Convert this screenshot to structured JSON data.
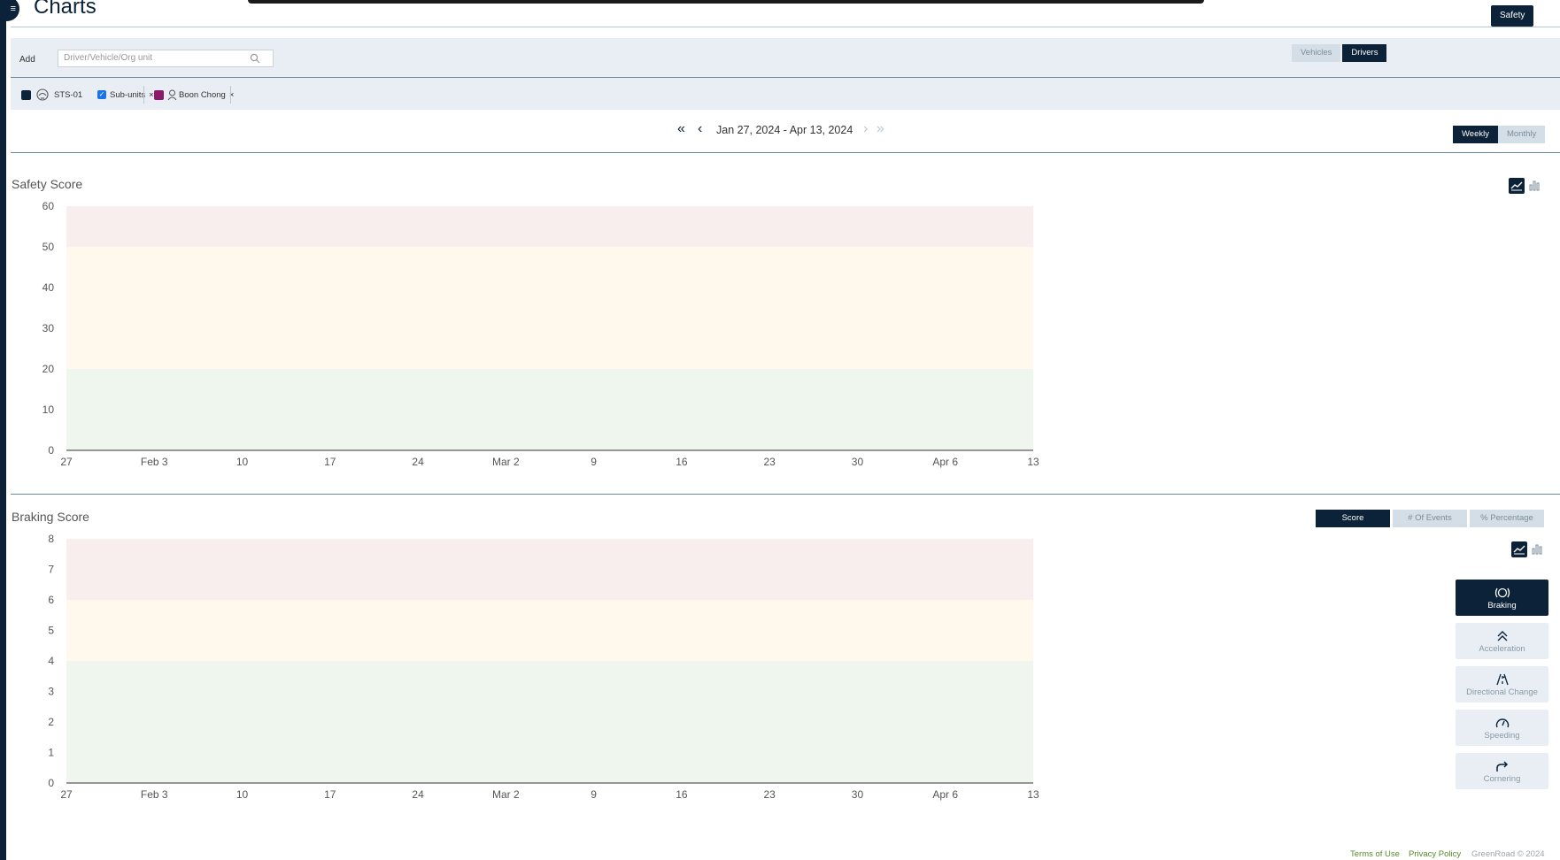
{
  "header": {
    "title": "Charts",
    "mode_button": "Safety"
  },
  "add_bar": {
    "label": "Add",
    "placeholder": "Driver/Vehicle/Org unit",
    "entity_toggle": [
      {
        "label": "Vehicles",
        "active": false
      },
      {
        "label": "Drivers",
        "active": true
      }
    ]
  },
  "filters": {
    "org_unit": {
      "label": "STS-01",
      "color": "#0b2238"
    },
    "subunits": {
      "label": "Sub-units",
      "checked": true
    },
    "driver": {
      "label": "Boon Chong",
      "color": "#8b1a6b"
    },
    "remove_symbol": "×"
  },
  "date_range": {
    "label": "Jan 27, 2024 - Apr 13, 2024"
  },
  "period_toggle": [
    {
      "label": "Weekly",
      "active": true
    },
    {
      "label": "Monthly",
      "active": false
    }
  ],
  "braking_toggle": [
    {
      "label": "Score",
      "active": true
    },
    {
      "label": "# Of Events",
      "active": false
    },
    {
      "label": "% Percentage",
      "active": false
    }
  ],
  "metrics": [
    {
      "label": "Braking",
      "icon": "braking-icon",
      "active": true
    },
    {
      "label": "Acceleration",
      "icon": "acceleration-icon",
      "active": false
    },
    {
      "label": "Directional Change",
      "icon": "directional-change-icon",
      "active": false
    },
    {
      "label": "Speeding",
      "icon": "speeding-icon",
      "active": false
    },
    {
      "label": "Cornering",
      "icon": "cornering-icon",
      "active": false
    }
  ],
  "footer": {
    "terms": "Terms of Use",
    "privacy": "Privacy Policy",
    "copyright": "GreenRoad © 2024"
  },
  "colors": {
    "brand": "#0b2238",
    "zone_red": "#f9eeee",
    "zone_yellow": "#fff8ec",
    "zone_green": "#eef6ed",
    "footer_link": "#5a8a2a"
  },
  "chart_data": [
    {
      "type": "line",
      "title": "Safety Score",
      "x": [
        "27",
        "Feb 3",
        "10",
        "17",
        "24",
        "Mar 2",
        "9",
        "16",
        "23",
        "30",
        "Apr 6",
        "13"
      ],
      "yticks": [
        0,
        10,
        20,
        30,
        40,
        50,
        60
      ],
      "ylim": [
        0,
        60
      ],
      "bands": [
        {
          "from": 0,
          "to": 20,
          "color": "green"
        },
        {
          "from": 20,
          "to": 50,
          "color": "yellow"
        },
        {
          "from": 50,
          "to": 60,
          "color": "red"
        }
      ],
      "series": [],
      "grid": false
    },
    {
      "type": "line",
      "title": "Braking Score",
      "x": [
        "27",
        "Feb 3",
        "10",
        "17",
        "24",
        "Mar 2",
        "9",
        "16",
        "23",
        "30",
        "Apr 6",
        "13"
      ],
      "yticks": [
        0,
        1,
        2,
        3,
        4,
        5,
        6,
        7,
        8
      ],
      "ylim": [
        0,
        8
      ],
      "bands": [
        {
          "from": 0,
          "to": 4,
          "color": "green"
        },
        {
          "from": 4,
          "to": 6,
          "color": "yellow"
        },
        {
          "from": 6,
          "to": 8,
          "color": "red"
        }
      ],
      "series": [],
      "grid": false
    }
  ]
}
